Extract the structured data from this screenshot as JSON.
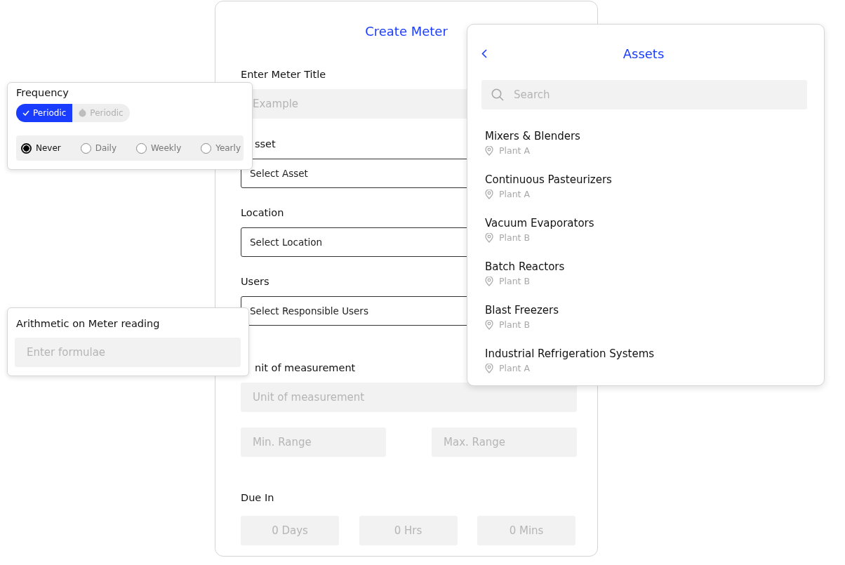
{
  "form": {
    "title": "Create Meter",
    "fields": [
      {
        "kind": "text",
        "label": "Enter Meter Title",
        "placeholder": "Example"
      },
      {
        "kind": "select",
        "label": "sset",
        "value": "Select Asset"
      },
      {
        "kind": "select",
        "label": "Location",
        "value": "Select Location"
      },
      {
        "kind": "select",
        "label": "Users",
        "value": "Select Responsible Users"
      },
      {
        "kind": "text",
        "label": "nit of measurement",
        "placeholder": "Unit of measurement"
      }
    ],
    "range": [
      {
        "placeholder": "Min. Range"
      },
      {
        "placeholder": "Max. Range"
      }
    ],
    "due_in": {
      "label": "Due In",
      "fields": [
        {
          "placeholder": "0 Days"
        },
        {
          "placeholder": "0 Hrs"
        },
        {
          "placeholder": "0 Mins"
        }
      ]
    }
  },
  "frequency_popup": {
    "title": "Frequency",
    "toggle": [
      {
        "label": "Periodic",
        "selected": true
      },
      {
        "label": "Periodic",
        "selected": false
      }
    ],
    "options": [
      {
        "label": "Never",
        "selected": true
      },
      {
        "label": "Daily",
        "selected": false
      },
      {
        "label": "Weekly",
        "selected": false
      },
      {
        "label": "Yearly",
        "selected": false
      }
    ]
  },
  "arithmetic_popup": {
    "title": "Arithmetic on Meter reading",
    "placeholder": "Enter formulae"
  },
  "assets_panel": {
    "title": "Assets",
    "search_placeholder": "Search",
    "items": [
      {
        "name": "Mixers & Blenders",
        "location": "Plant A"
      },
      {
        "name": "Continuous Pasteurizers",
        "location": "Plant A"
      },
      {
        "name": "Vacuum Evaporators",
        "location": "Plant B"
      },
      {
        "name": "Batch Reactors",
        "location": "Plant B"
      },
      {
        "name": "Blast Freezers",
        "location": "Plant B"
      },
      {
        "name": "Industrial Refrigeration Systems",
        "location": "Plant A"
      }
    ]
  }
}
